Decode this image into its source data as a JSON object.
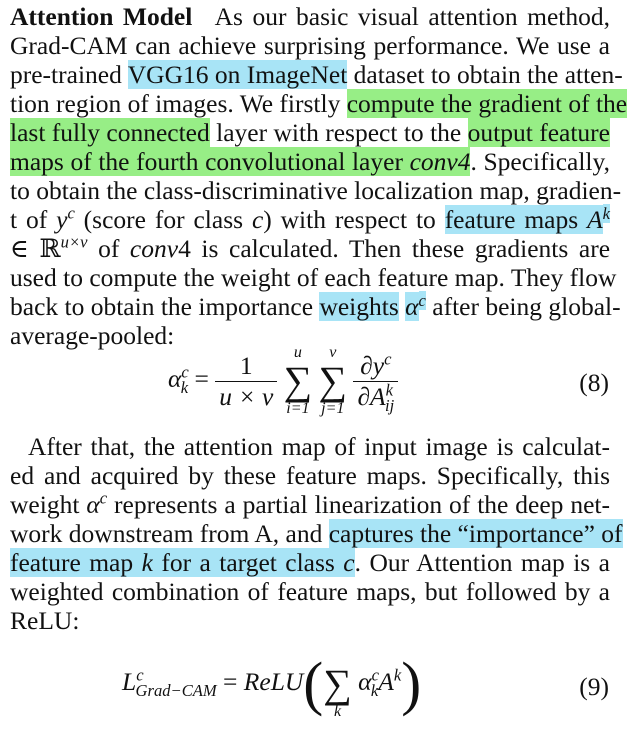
{
  "paragraph1": {
    "heading": "Attention Model",
    "lines": [
      {
        "segments": [
          {
            "t": "As our basic visual attention method,"
          }
        ]
      },
      {
        "segments": [
          {
            "t": "Grad-CAM can achieve surprising performance. We use a"
          }
        ]
      },
      {
        "segments": [
          {
            "t": "pre-trained "
          },
          {
            "t": "VGG16 on ImageNet",
            "hl": "blue"
          },
          {
            "t": " dataset to obtain the atten-"
          }
        ]
      },
      {
        "segments": [
          {
            "t": "tion region of images. We firstly "
          },
          {
            "t": "compute the gradient of the",
            "hl": "green"
          }
        ]
      },
      {
        "segments": [
          {
            "t": "last fully connected",
            "hl": "green"
          },
          {
            "t": " layer with respect to the "
          },
          {
            "t": "output feature",
            "hl": "green"
          }
        ]
      },
      {
        "segments": [
          {
            "t": "maps of the fourth convolutional layer ",
            "hl": "green"
          },
          {
            "t": "conv4",
            "hl": "green",
            "i": true
          },
          {
            "t": ". Specifically,"
          }
        ]
      },
      {
        "segments": [
          {
            "t": "to obtain the class-discriminative localization map, gradien-"
          }
        ]
      },
      {
        "segments": [
          {
            "t": "t of "
          },
          {
            "t": "y",
            "i": true
          },
          {
            "t": "c",
            "sup": true,
            "i": true
          },
          {
            "t": " (score for class "
          },
          {
            "t": "c",
            "i": true
          },
          {
            "t": ") with respect to "
          },
          {
            "t": "feature maps ",
            "hl": "blue"
          },
          {
            "t": "A",
            "hl": "blue",
            "i": true
          },
          {
            "t": "k",
            "hl": "blue",
            "i": true,
            "sup": true
          }
        ]
      },
      {
        "segments": [
          {
            "t": "∈ ℝ"
          },
          {
            "t": "u×v",
            "sup": true,
            "i": true
          },
          {
            "t": " of "
          },
          {
            "t": "conv",
            "i": true
          },
          {
            "t": "4 is calculated. Then these gradients are"
          }
        ]
      },
      {
        "segments": [
          {
            "t": "used to compute the weight of each feature map. They flow"
          }
        ]
      },
      {
        "segments": [
          {
            "t": "back to obtain the importance "
          },
          {
            "t": "weights",
            "hl": "blue"
          },
          {
            "t": " "
          },
          {
            "t": "α",
            "hl": "blue",
            "i": true
          },
          {
            "t": "c",
            "hl": "blue",
            "i": true,
            "sup": true
          },
          {
            "t": " after being global-"
          }
        ]
      },
      {
        "segments": [
          {
            "t": "average-pooled:"
          }
        ],
        "last": true
      }
    ]
  },
  "equation8": {
    "lhs": "α",
    "lhs_sup": "c",
    "lhs_sub": "k",
    "equals": "=",
    "frac_num": "1",
    "frac_den": "u × v",
    "sum1_upper": "u",
    "sum1_lower": "i=1",
    "sum2_upper": "v",
    "sum2_lower": "j=1",
    "deriv_num": "∂y",
    "deriv_num_sup": "c",
    "deriv_den": "∂A",
    "deriv_den_sup": "k",
    "deriv_den_sub": "ij",
    "number": "(8)"
  },
  "paragraph2": {
    "lines": [
      {
        "segments": [
          {
            "t": "After that, the attention map of input image is calculat-"
          }
        ],
        "indent": true
      },
      {
        "segments": [
          {
            "t": "ed and acquired by these feature maps. Specifically, this"
          }
        ]
      },
      {
        "segments": [
          {
            "t": "weight "
          },
          {
            "t": "α",
            "i": true
          },
          {
            "t": "c",
            "i": true,
            "sup": true
          },
          {
            "t": " represents a partial linearization of the deep net-"
          }
        ]
      },
      {
        "segments": [
          {
            "t": "work downstream from A, and "
          },
          {
            "t": "captures the “importance” of",
            "hl": "blue"
          }
        ]
      },
      {
        "segments": [
          {
            "t": "feature map ",
            "hl": "blue"
          },
          {
            "t": "k",
            "hl": "blue",
            "i": true
          },
          {
            "t": " for a target class ",
            "hl": "blue"
          },
          {
            "t": "c",
            "hl": "blue",
            "i": true
          },
          {
            "t": ". Our Attention map is a"
          }
        ]
      },
      {
        "segments": [
          {
            "t": "weighted combination of feature maps, but followed by a"
          }
        ]
      },
      {
        "segments": [
          {
            "t": "ReLU:"
          }
        ],
        "last": true
      }
    ]
  },
  "equation9": {
    "lhs": "L",
    "lhs_sup": "c",
    "lhs_sub": "Grad−CAM",
    "equals": "=",
    "func": "ReLU",
    "sum_lower": "k",
    "term": "α",
    "term_sup": "c",
    "term_sub": "k",
    "term2": "A",
    "term2_sup": "k",
    "number": "(9)"
  },
  "colors": {
    "highlight_blue": "#a8e4f6",
    "highlight_green": "#97ee86"
  }
}
